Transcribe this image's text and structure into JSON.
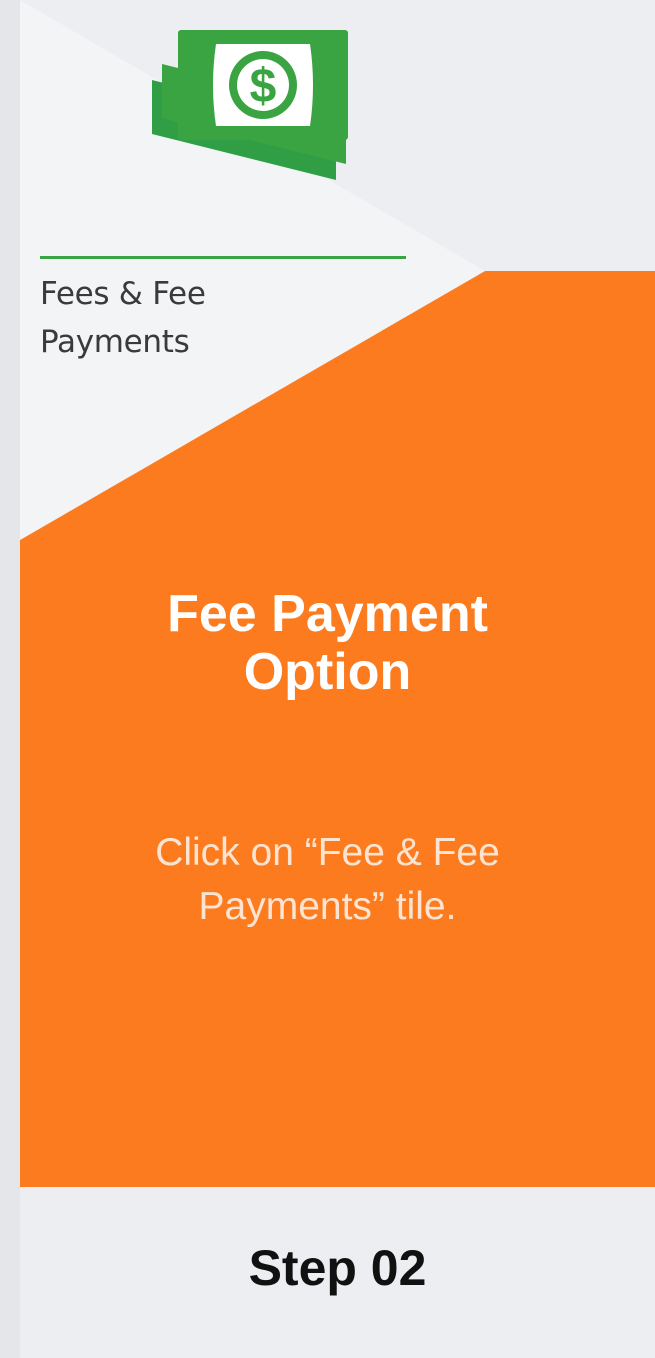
{
  "tile": {
    "icon": "money-icon",
    "label_line1": "Fees & Fee",
    "label_line2": "Payments"
  },
  "step": {
    "title_line1": "Fee Payment",
    "title_line2": "Option",
    "description_line1": "Click on “Fee & Fee",
    "description_line2": "Payments” tile.",
    "number": "Step 02"
  },
  "colors": {
    "accent_orange": "#fd7b1f",
    "icon_green": "#3aa443",
    "background": "#eceef1"
  }
}
